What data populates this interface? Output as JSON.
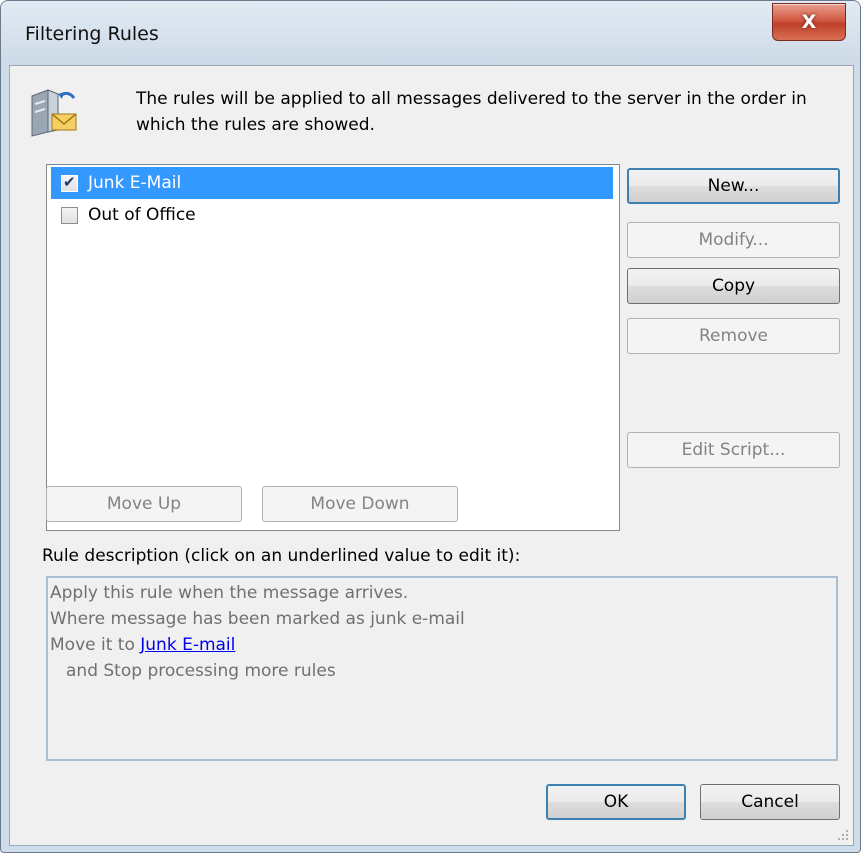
{
  "window": {
    "title": "Filtering Rules",
    "close_label": "X"
  },
  "header": {
    "text": "The rules will be applied to all messages delivered to the server in the order in which the rules are showed."
  },
  "rules": [
    {
      "label": "Junk E-Mail",
      "checked": true,
      "selected": true
    },
    {
      "label": "Out of Office",
      "checked": false,
      "selected": false
    }
  ],
  "buttons": {
    "new": "New...",
    "modify": "Modify...",
    "copy": "Copy",
    "remove": "Remove",
    "edit_script": "Edit Script...",
    "move_up": "Move Up",
    "move_down": "Move Down",
    "ok": "OK",
    "cancel": "Cancel"
  },
  "description": {
    "label": "Rule description (click on an underlined value to edit it):",
    "line1": "Apply this rule when the message arrives.",
    "line2": "Where message has been marked as junk e-mail",
    "line3_prefix": "Move it to ",
    "line3_link": "Junk E-mail",
    "line4": "and Stop processing more rules"
  },
  "icons": {
    "header": "server-mail-icon",
    "close": "close-icon",
    "grip": "resize-grip-icon"
  },
  "colors": {
    "selection": "#3399ff",
    "link": "#0000ee",
    "close_button": "#c0402a"
  }
}
